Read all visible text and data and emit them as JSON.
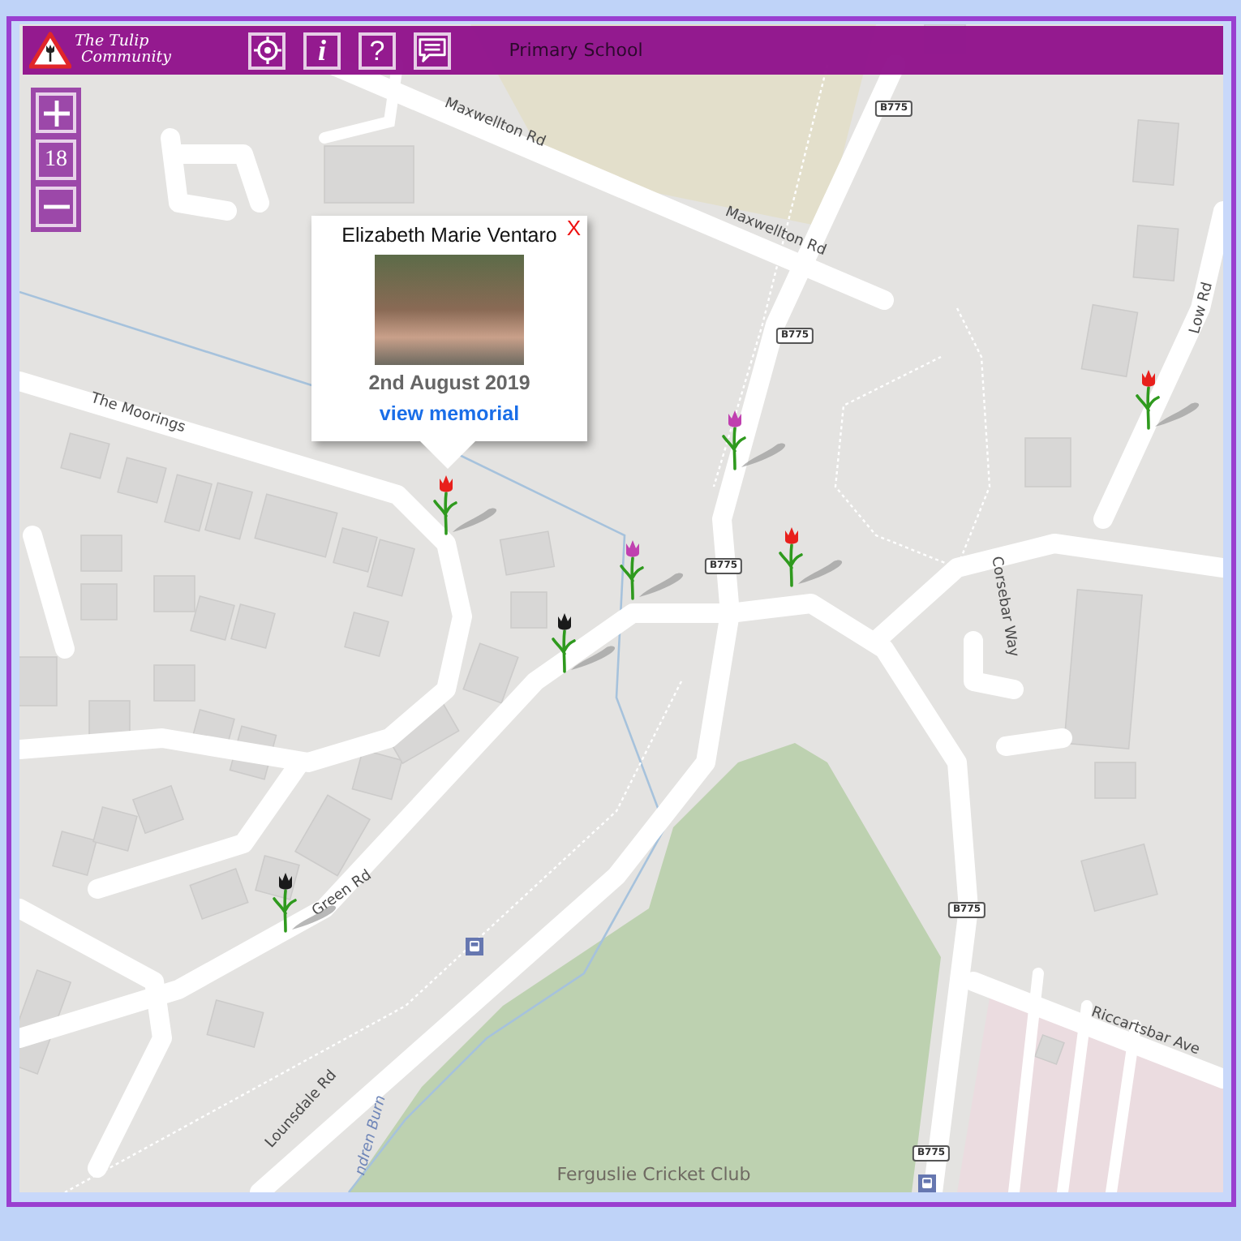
{
  "header": {
    "logo_text": [
      "The Tulip",
      "Community"
    ],
    "buttons": [
      {
        "kind": "locate"
      },
      {
        "kind": "info",
        "label": "i"
      },
      {
        "kind": "help",
        "label": "?"
      },
      {
        "kind": "chat"
      }
    ]
  },
  "zoom": {
    "level_label": "18"
  },
  "popup": {
    "name": "Elizabeth Marie Ventaro",
    "date": "2nd August 2019",
    "link": "view memorial",
    "close": "X"
  },
  "map": {
    "labels": [
      {
        "text": "Primary School",
        "kind": "place"
      },
      {
        "text": "Maxwellton Rd",
        "kind": "street"
      },
      {
        "text": "Maxwellton Rd",
        "kind": "street"
      },
      {
        "text": "Low Rd",
        "kind": "street"
      },
      {
        "text": "The Moorings",
        "kind": "street"
      },
      {
        "text": "Corsebar Way",
        "kind": "street"
      },
      {
        "text": "Green Rd",
        "kind": "street"
      },
      {
        "text": "Lounsdale Rd",
        "kind": "street"
      },
      {
        "text": "Riccartsbar Ave",
        "kind": "street"
      },
      {
        "text": "ndren Burn",
        "kind": "water"
      },
      {
        "text": "Ferguslie Cricket Club",
        "kind": "place"
      }
    ],
    "road_shields": [
      "B775",
      "B775",
      "B775",
      "B775",
      "B775"
    ]
  },
  "tulips": [
    {
      "color": "#e8201c"
    },
    {
      "color": "#c040b0"
    },
    {
      "color": "#e8201c"
    },
    {
      "color": "#c040b0"
    },
    {
      "color": "#e8201c"
    },
    {
      "color": "#1a1a1a"
    },
    {
      "color": "#1a1a1a"
    }
  ]
}
